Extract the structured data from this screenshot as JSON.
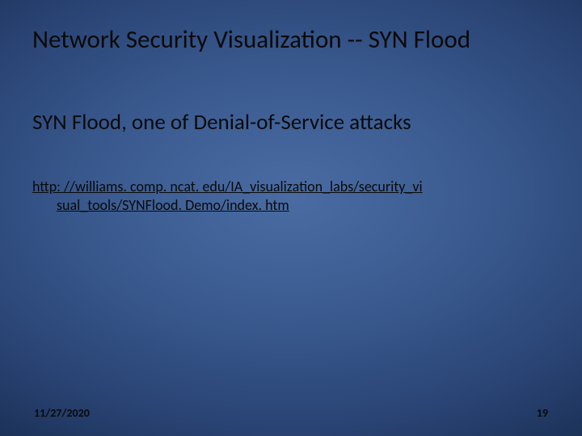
{
  "slide": {
    "title": "Network Security Visualization -- SYN Flood",
    "subtitle": "SYN Flood, one of Denial-of-Service attacks",
    "link_line1": "http: //williams. comp. ncat. edu/IA_visualization_labs/security_vi",
    "link_line2": "sual_tools/SYNFlood. Demo/index. htm",
    "footer_date": "11/27/2020",
    "footer_page": "19"
  }
}
